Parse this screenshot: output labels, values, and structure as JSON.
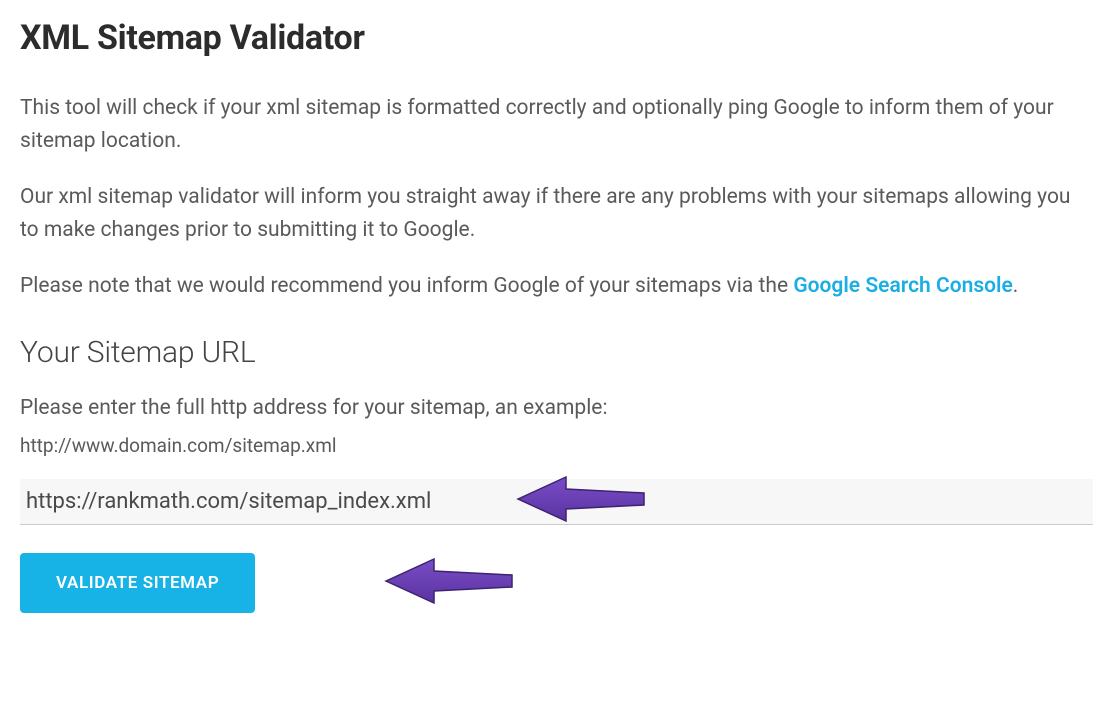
{
  "page": {
    "title": "XML Sitemap Validator",
    "intro1": "This tool will check if your xml sitemap is formatted correctly and optionally ping Google to inform them of your sitemap location.",
    "intro2": "Our xml sitemap validator will inform you straight away if there are any problems with your sitemaps allowing you to make changes prior to submitting it to Google.",
    "intro3_prefix": "Please note that we would recommend you inform Google of your sitemaps via the ",
    "intro3_link": "Google Search Console",
    "intro3_suffix": "."
  },
  "form": {
    "section_title": "Your Sitemap URL",
    "instruction": "Please enter the full http address for your sitemap, an example:",
    "example": "http://www.domain.com/sitemap.xml",
    "input_value": "https://rankmath.com/sitemap_index.xml",
    "button_label": "VALIDATE SITEMAP"
  },
  "annotation": {
    "arrow_fill": "#6a3db8",
    "arrow_stroke": "#4a2a80"
  }
}
